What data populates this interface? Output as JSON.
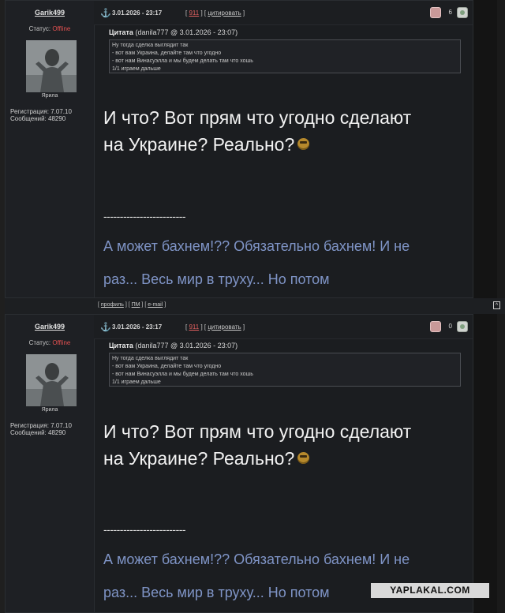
{
  "posts": [
    {
      "author": "Garik499",
      "status_label": "Статус:",
      "status_value": "Offline",
      "nickname": "Ярила",
      "reg": "Регистрация: 7.07.10",
      "msgs": "Сообщений: 48290",
      "datetime": "3.01.2026 - 23:17",
      "num": "911",
      "cite": "цитировать",
      "rating": "6",
      "quote_label": "Цитата",
      "quote_src": "(danila777 @ 3.01.2026 - 23:07)",
      "quote_lines": [
        "Ну тогда сделка выглядит так",
        "- вот вам Украина, делайте там что угодно",
        "- вот нам Винасуэлла и мы будем делать там что хошь",
        "1/1 играем дальше"
      ],
      "body_line1": "И что? Вот прям что угодно сделают",
      "body_line2": "на Украине? Реально?",
      "dashes": "-------------------------",
      "sig_line1": "А может бахнем!?? Обязательно бахнем! И не",
      "sig_line2": "раз... Весь мир в труху... Но потом"
    },
    {
      "author": "Garik499",
      "status_label": "Статус:",
      "status_value": "Offline",
      "nickname": "Ярила",
      "reg": "Регистрация: 7.07.10",
      "msgs": "Сообщений: 48290",
      "datetime": "3.01.2026 - 23:17",
      "num": "911",
      "cite": "цитировать",
      "rating": "0",
      "quote_label": "Цитата",
      "quote_src": "(danila777 @ 3.01.2026 - 23:07)",
      "quote_lines": [
        "Ну тогда сделка выглядит так",
        "- вот вам Украина, делайте там что угодно",
        "- вот нам Винасуэлла и мы будем делать там что хошь",
        "1/1 играем дальше"
      ],
      "body_line1": "И что? Вот прям что угодно сделают",
      "body_line2": "на Украине? Реально?",
      "dashes": "-------------------------",
      "sig_line1": "А может бахнем!?? Обязательно бахнем! И не",
      "sig_line2": "раз... Весь мир в труху... Но потом"
    }
  ],
  "footer": {
    "profile": "профиль",
    "pm": "ПМ",
    "email": "e-mail",
    "top": "^"
  },
  "watermark": "YAPLAKAL.COM"
}
